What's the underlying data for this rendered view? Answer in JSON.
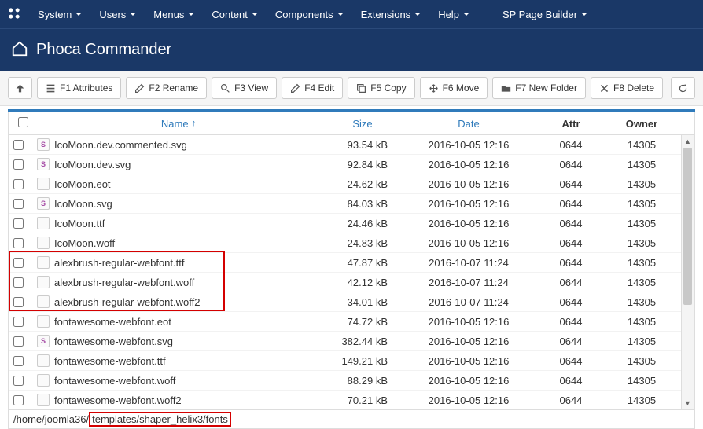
{
  "topnav": {
    "items": [
      "System",
      "Users",
      "Menus",
      "Content",
      "Components",
      "Extensions",
      "Help",
      "SP Page Builder"
    ]
  },
  "page_title": "Phoca Commander",
  "toolbar": {
    "btn_attributes": "F1 Attributes",
    "btn_rename": "F2 Rename",
    "btn_view": "F3 View",
    "btn_edit": "F4 Edit",
    "btn_copy": "F5 Copy",
    "btn_move": "F6 Move",
    "btn_newfolder": "F7 New Folder",
    "btn_delete": "F8 Delete"
  },
  "columns": {
    "name": "Name",
    "size": "Size",
    "date": "Date",
    "attr": "Attr",
    "owner": "Owner"
  },
  "files": [
    {
      "icon": "S",
      "name": "IcoMoon.dev.commented.svg",
      "size": "93.54 kB",
      "date": "2016-10-05 12:16",
      "attr": "0644",
      "owner": "14305"
    },
    {
      "icon": "S",
      "name": "IcoMoon.dev.svg",
      "size": "92.84 kB",
      "date": "2016-10-05 12:16",
      "attr": "0644",
      "owner": "14305"
    },
    {
      "icon": "",
      "name": "IcoMoon.eot",
      "size": "24.62 kB",
      "date": "2016-10-05 12:16",
      "attr": "0644",
      "owner": "14305"
    },
    {
      "icon": "S",
      "name": "IcoMoon.svg",
      "size": "84.03 kB",
      "date": "2016-10-05 12:16",
      "attr": "0644",
      "owner": "14305"
    },
    {
      "icon": "",
      "name": "IcoMoon.ttf",
      "size": "24.46 kB",
      "date": "2016-10-05 12:16",
      "attr": "0644",
      "owner": "14305"
    },
    {
      "icon": "",
      "name": "IcoMoon.woff",
      "size": "24.83 kB",
      "date": "2016-10-05 12:16",
      "attr": "0644",
      "owner": "14305"
    },
    {
      "icon": "",
      "name": "alexbrush-regular-webfont.ttf",
      "size": "47.87 kB",
      "date": "2016-10-07 11:24",
      "attr": "0644",
      "owner": "14305"
    },
    {
      "icon": "",
      "name": "alexbrush-regular-webfont.woff",
      "size": "42.12 kB",
      "date": "2016-10-07 11:24",
      "attr": "0644",
      "owner": "14305"
    },
    {
      "icon": "",
      "name": "alexbrush-regular-webfont.woff2",
      "size": "34.01 kB",
      "date": "2016-10-07 11:24",
      "attr": "0644",
      "owner": "14305"
    },
    {
      "icon": "",
      "name": "fontawesome-webfont.eot",
      "size": "74.72 kB",
      "date": "2016-10-05 12:16",
      "attr": "0644",
      "owner": "14305"
    },
    {
      "icon": "S",
      "name": "fontawesome-webfont.svg",
      "size": "382.44 kB",
      "date": "2016-10-05 12:16",
      "attr": "0644",
      "owner": "14305"
    },
    {
      "icon": "",
      "name": "fontawesome-webfont.ttf",
      "size": "149.21 kB",
      "date": "2016-10-05 12:16",
      "attr": "0644",
      "owner": "14305"
    },
    {
      "icon": "",
      "name": "fontawesome-webfont.woff",
      "size": "88.29 kB",
      "date": "2016-10-05 12:16",
      "attr": "0644",
      "owner": "14305"
    },
    {
      "icon": "",
      "name": "fontawesome-webfont.woff2",
      "size": "70.21 kB",
      "date": "2016-10-05 12:16",
      "attr": "0644",
      "owner": "14305"
    }
  ],
  "path": {
    "prefix": "/home/joomla36/",
    "highlighted": "templates/shaper_helix3/fonts"
  }
}
